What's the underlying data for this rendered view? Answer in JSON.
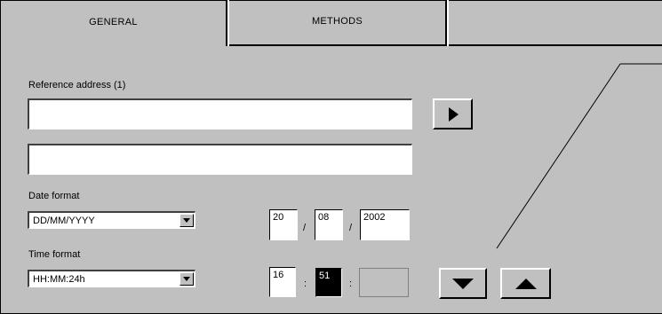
{
  "tabs": [
    {
      "label": "GENERAL",
      "active": true
    },
    {
      "label": "METHODS",
      "active": false
    }
  ],
  "reference": {
    "label": "Reference address (1)",
    "line1_value": "",
    "line2_value": "",
    "go_icon": "play-icon"
  },
  "date": {
    "label": "Date format",
    "format_selected": "DD/MM/YYYY",
    "day": "20",
    "month": "08",
    "year": "2002",
    "separator": "/"
  },
  "time": {
    "label": "Time format",
    "format_selected": "HH:MM:24h",
    "hours": "16",
    "minutes": "51",
    "seconds": "",
    "separator": ":"
  },
  "controls": {
    "down_icon": "triangle-down-icon",
    "up_icon": "triangle-up-icon"
  },
  "colors": {
    "panel_bg": "#c0c0c0",
    "selected_field_bg": "#000000"
  }
}
